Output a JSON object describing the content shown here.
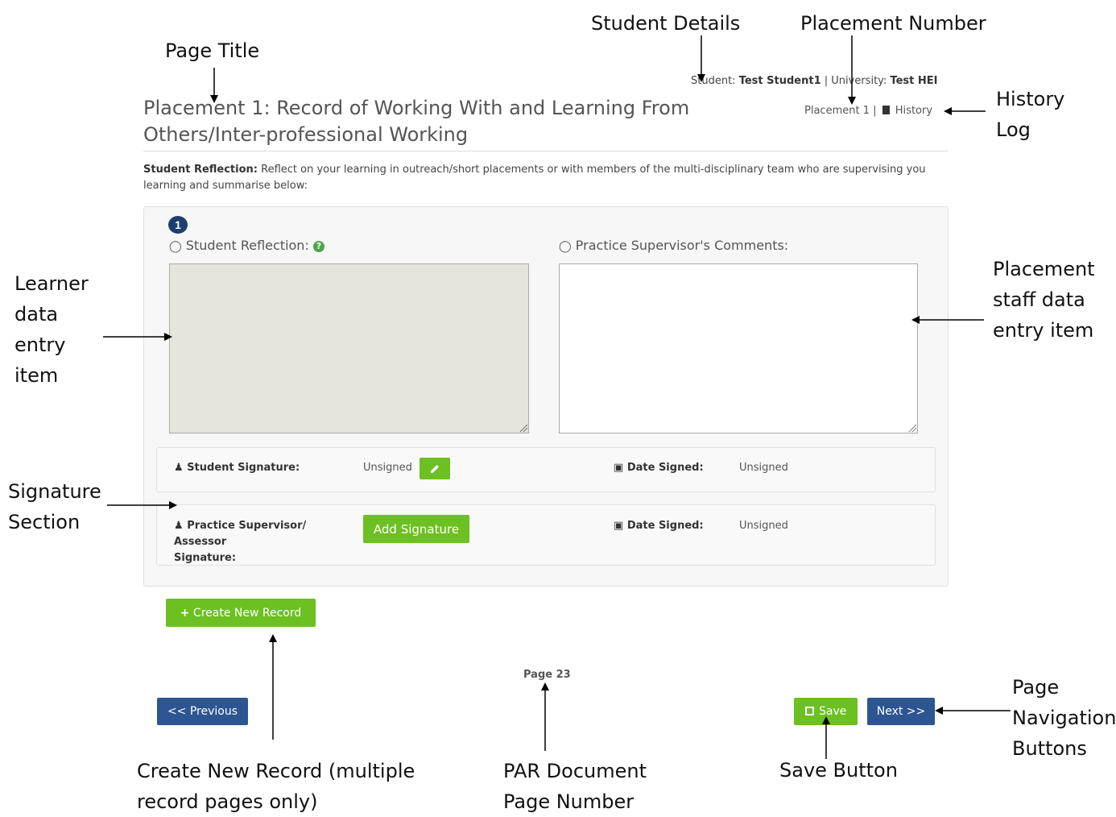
{
  "annotations": {
    "page_title": "Page Title",
    "student_details": "Student Details",
    "placement_number": "Placement Number",
    "history_log_line1": "History",
    "history_log_line2": "Log",
    "learner_entry": [
      "Learner",
      "data",
      "entry",
      "item"
    ],
    "staff_entry": [
      "Placement",
      "staff data",
      "entry item"
    ],
    "signature_section": [
      "Signature",
      "Section"
    ],
    "create_new_record": [
      "Create New Record (multiple",
      "record pages only)"
    ],
    "par_page_number": [
      "PAR Document",
      "Page Number"
    ],
    "save_button": "Save Button",
    "page_navigation": [
      "Page",
      "Navigation",
      "Buttons"
    ]
  },
  "header": {
    "student_label": "Student:",
    "student_name": "Test Student1",
    "separator": "|",
    "university_label": "University:",
    "university_name": "Test HEI",
    "placement_label": "Placement 1",
    "history_label": "History"
  },
  "page_title": "Placement 1: Record of Working With and Learning From Others/Inter-professional Working",
  "instructions": {
    "bold": "Student Reflection:",
    "text": "Reflect on your learning in outreach/short placements or with members of the multi-disciplinary team who are supervising you learning and summarise below:"
  },
  "record": {
    "number": "1",
    "student_reflection_label": "Student Reflection:",
    "supervisor_comments_label": "Practice Supervisor's Comments:",
    "student_reflection_value": "",
    "supervisor_comments_value": ""
  },
  "signatures": {
    "student_label": "Student Signature:",
    "student_status": "Unsigned",
    "student_date_label": "Date Signed:",
    "student_date_value": "Unsigned",
    "supervisor_label_line1": "Practice Supervisor/ Assessor",
    "supervisor_label_line2": "Signature:",
    "add_signature_button": "Add Signature",
    "supervisor_date_label": "Date Signed:",
    "supervisor_date_value": "Unsigned"
  },
  "buttons": {
    "create_new_record": "Create New Record",
    "previous": "<< Previous",
    "save": "Save",
    "next": "Next >>"
  },
  "page_number": "Page 23"
}
